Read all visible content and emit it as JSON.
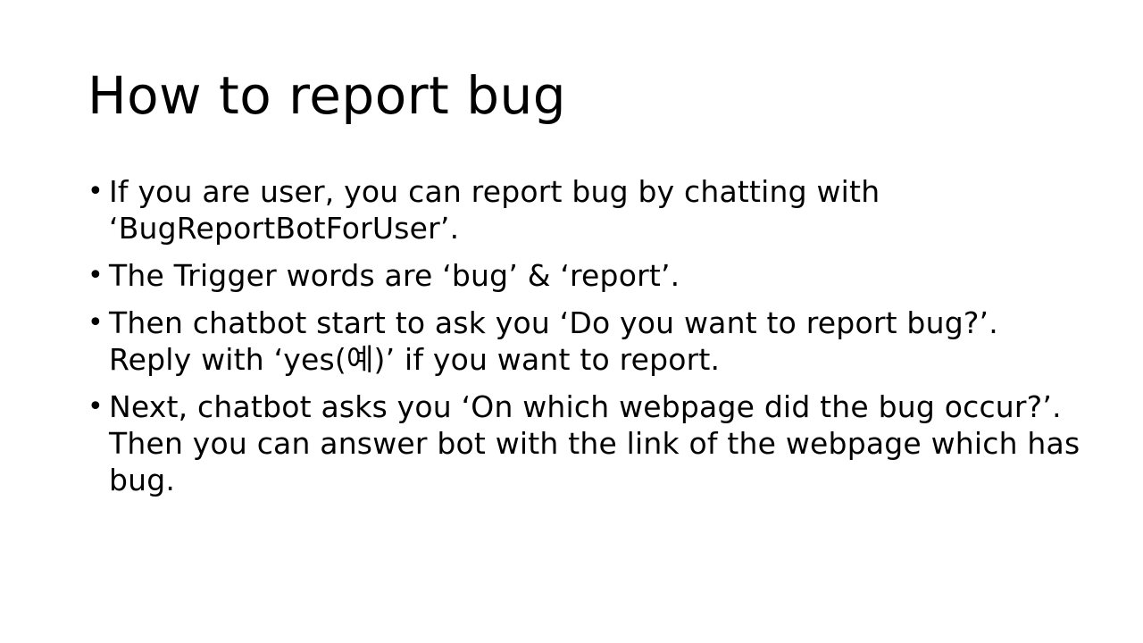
{
  "slide": {
    "title": "How to report bug",
    "bullet_glyph": "•",
    "bullets": [
      {
        "text": "If you are user, you can report bug by chatting with ‘BugReportBotForUser’."
      },
      {
        "text": "The Trigger words are ‘bug’ & ‘report’."
      },
      {
        "text": "Then chatbot start to ask you ‘Do you want to report bug?’. Reply with ‘yes(예)’ if you want to report."
      },
      {
        "text": "Next, chatbot asks you ‘On which webpage did the bug occur?’. Then you can answer bot with the link of the webpage which has bug."
      }
    ]
  }
}
